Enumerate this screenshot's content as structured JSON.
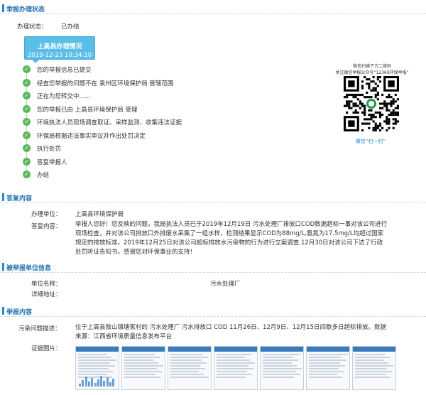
{
  "sections": {
    "status": "举报办理状态",
    "reply": "答复内容",
    "unit": "被举报单位信息",
    "content": "举报内容"
  },
  "status": {
    "label": "办理状态：",
    "value": "已办结",
    "box_title": "上高县办理情况",
    "box_time": "2019-12-23 10:34:10",
    "steps": [
      "您的举报信息已提交",
      "经查您举报的问题不在 袁州区环境保护局 管辖范围",
      "正在为您转交中......",
      "您的举报已由 上高县环境保护局 受理",
      "环境执法人员现场调查取证、采样监测、收集违法证据",
      "环保局根据违法事实审议并作出处罚决定",
      "执行处罚",
      "答复举报人",
      "办结"
    ]
  },
  "qr": {
    "caption1": "微信扫描下方二维码",
    "caption2": "关注微信举报公众号“12369环保举报”",
    "scan_label": "微信“扫一扫”"
  },
  "reply": {
    "unit_label": "办理单位：",
    "unit_value": "上高县环境保护局",
    "content_label": "答复内容：",
    "content_value": "举报人您好！您反映的问题，我局执法人员已于2019年12月19日 污水处理厂排放口COD数据超标一事对该公司进行现场检查，并对该公司排放口外排废水采集了一组水样，检测结果显示COD为88mg/L,氨氮为17.5mg/L均超过国家规定的排放标准。2019年12月25日对该公司超标排放水污染物的行为进行立案调查,12月30日对该公司下达了行政处罚听证告知书。感谢您对环保事业的支持！"
  },
  "unit": {
    "name_label": "单位名称：",
    "name_value": "污水处理厂",
    "address_label": "详细地址："
  },
  "content": {
    "issue_label": "污染问题描述：",
    "issue_value": "位于上高县敖山镇塘家村的 污水处理厂 污水排放口 COD 11月26日、12月9日、12月15日间歇多日超标排放。数据来源：江西省环境质量信息发布平台",
    "photos_label": "证据图片："
  },
  "thumbnails": [
    "evidence-image-1",
    "evidence-image-2",
    "evidence-image-3",
    "evidence-image-4",
    "evidence-image-5",
    "evidence-image-6",
    "evidence-image-7"
  ],
  "colors": {
    "accent": "#2a86c8",
    "step_ok": "#5db85c",
    "status_box": "#5bbee6"
  }
}
